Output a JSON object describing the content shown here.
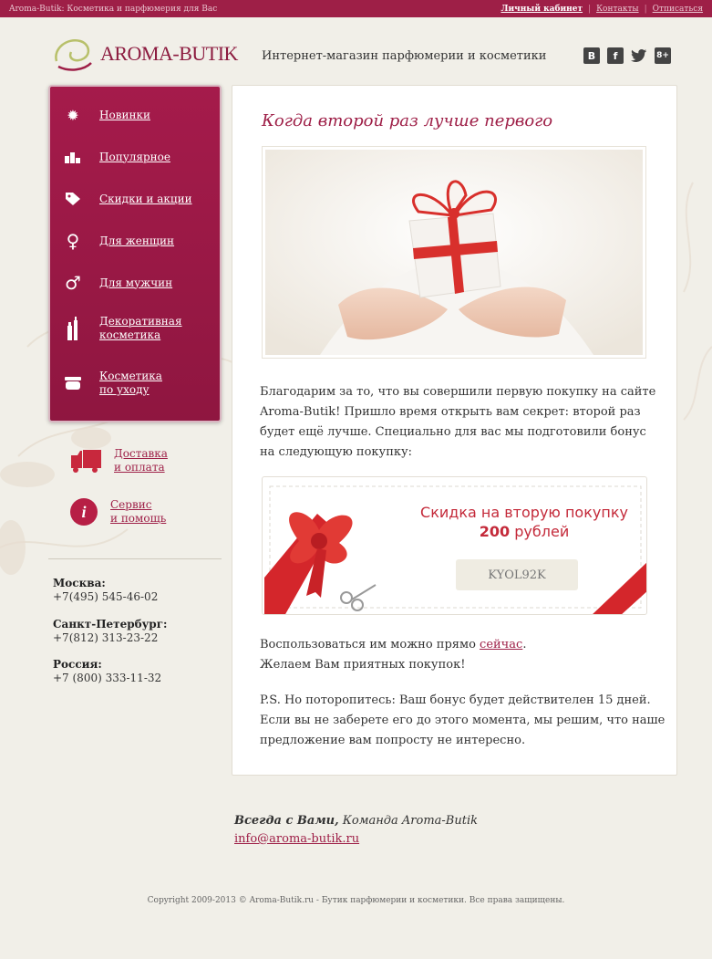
{
  "topbar": {
    "tagline": "Aroma-Butik: Косметика и парфюмерия для Вас",
    "cabinet": "Личный кабинет",
    "contacts": "Контакты",
    "unsubscribe": "Отписаться",
    "separator": "|"
  },
  "header": {
    "logo_text": "AROMA-BUTIK",
    "tagline": "Интернет-магазин парфюмерии и косметики",
    "socials": [
      {
        "icon": "vk-icon",
        "label": "B"
      },
      {
        "icon": "facebook-icon",
        "label": "f"
      },
      {
        "icon": "twitter-icon",
        "label": "🐦"
      },
      {
        "icon": "google-plus-icon",
        "label": "8+"
      }
    ]
  },
  "sidebar": {
    "items": [
      {
        "icon": "new-icon",
        "label": "Новинки"
      },
      {
        "icon": "popular-icon",
        "label": "Популярное"
      },
      {
        "icon": "tag-icon",
        "label": "Скидки и акции"
      },
      {
        "icon": "female-icon",
        "label": "Для женщин"
      },
      {
        "icon": "male-icon",
        "label": "Для мужчин"
      },
      {
        "icon": "cosmetics-icon",
        "label": "Декоративная\nкосметика"
      },
      {
        "icon": "cream-icon",
        "label": "Косметика\nпо уходу"
      }
    ],
    "delivery": "Доставка\nи оплата",
    "service": "Сервис\nи помощь",
    "contacts": [
      {
        "city": "Москва:",
        "phone": "+7(495) 545-46-02"
      },
      {
        "city": "Санкт-Петербург:",
        "phone": "+7(812) 313-23-22"
      },
      {
        "city": "Россия:",
        "phone": "+7 (800) 333-11-32"
      }
    ]
  },
  "main": {
    "title": "Когда второй раз лучше первого",
    "intro": "Благодарим за то, что вы совершили первую покупку на сайте Aroma-Butik! Пришло время открыть вам секрет: второй раз будет ещё лучше.  Специально для вас мы подготовили бонус на следующую покупку:",
    "coupon": {
      "title": "Скидка на вторую покупку",
      "amount": "200",
      "currency": " рублей",
      "code": "KYOL92K"
    },
    "use_prefix": "Воспользоваться им можно прямо ",
    "use_link": "сейчас",
    "use_suffix": ".",
    "wish": "Желаем Вам приятных покупок!",
    "ps": "P.S. Но поторопитесь: Ваш бонус будет действителен 15 дней. Если вы не заберете его до этого момента, мы решим, что наше предложение вам попросту не интересно."
  },
  "footer": {
    "signature_bold": "Всегда с Вами,",
    "signature_rest": " Команда Aroma-Butik",
    "email": "info@aroma-butik.ru",
    "copyright": "Copyright 2009-2013 © Aroma-Butik.ru - Бутик парфюмерии и косметики. Все права защищены."
  }
}
